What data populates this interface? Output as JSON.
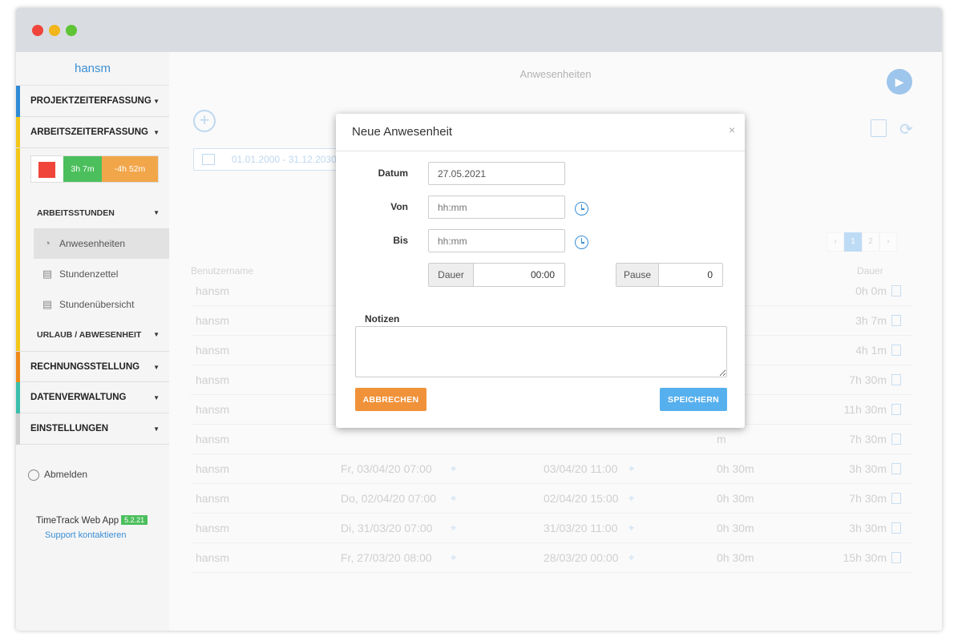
{
  "sidebar": {
    "username": "hansm",
    "sections": {
      "projekt": "PROJEKTZEITERFASSUNG",
      "arbeit": "ARBEITSZEITERFASSUNG",
      "rechnung": "RECHNUNGSSTELLUNG",
      "daten": "DATENVERWALTUNG",
      "einstellungen": "EINSTELLUNGEN"
    },
    "timer": {
      "worked": "3h 7m",
      "remaining": "-4h 52m"
    },
    "sub": {
      "arbeitsstunden": "ARBEITSSTUNDEN",
      "urlaub": "URLAUB / ABWESENHEIT"
    },
    "items": {
      "anwesenheiten": "Anwesenheiten",
      "stundenzettel": "Stundenzettel",
      "stundenuebersicht": "Stundenübersicht"
    },
    "logout": "Abmelden",
    "app_name": "TimeTrack Web App",
    "version": "5.2.21",
    "support": "Support kontaktieren"
  },
  "main": {
    "title": "Anwesenheiten",
    "date_range": "01.01.2000 - 31.12.2030",
    "pager": [
      "‹",
      "1",
      "2",
      "›"
    ],
    "columns": {
      "user": "Benutzername",
      "duration": "Dauer"
    },
    "rows": [
      {
        "user": "hansm",
        "from": "",
        "to": "",
        "pause": "h",
        "duration": "0h 0m"
      },
      {
        "user": "hansm",
        "from": "",
        "to": "",
        "pause": "h",
        "duration": "3h 7m"
      },
      {
        "user": "hansm",
        "from": "",
        "to": "",
        "pause": "h",
        "duration": "4h 1m"
      },
      {
        "user": "hansm",
        "from": "",
        "to": "",
        "pause": "m",
        "duration": "7h 30m"
      },
      {
        "user": "hansm",
        "from": "",
        "to": "",
        "pause": "m",
        "duration": "11h 30m"
      },
      {
        "user": "hansm",
        "from": "",
        "to": "",
        "pause": "m",
        "duration": "7h 30m"
      },
      {
        "user": "hansm",
        "from": "Fr, 03/04/20 07:00",
        "to": "03/04/20 11:00",
        "pause": "0h 30m",
        "duration": "3h 30m"
      },
      {
        "user": "hansm",
        "from": "Do, 02/04/20 07:00",
        "to": "02/04/20 15:00",
        "pause": "0h 30m",
        "duration": "7h 30m"
      },
      {
        "user": "hansm",
        "from": "Di, 31/03/20 07:00",
        "to": "31/03/20 11:00",
        "pause": "0h 30m",
        "duration": "3h 30m"
      },
      {
        "user": "hansm",
        "from": "Fr, 27/03/20 08:00",
        "to": "28/03/20 00:00",
        "pause": "0h 30m",
        "duration": "15h 30m"
      }
    ]
  },
  "modal": {
    "title": "Neue Anwesenheit",
    "close": "×",
    "datum_label": "Datum",
    "datum_value": "27.05.2021",
    "von_label": "Von",
    "von_placeholder": "hh:mm",
    "bis_label": "Bis",
    "bis_placeholder": "hh:mm",
    "dauer_label": "Dauer",
    "dauer_value": "00:00",
    "pause_label": "Pause",
    "pause_value": "0",
    "notizen_label": "Notizen",
    "cancel": "ABBRECHEN",
    "save": "SPEICHERN"
  },
  "colors": {
    "accent": "#3a8fd6",
    "cancel": "#f0923a",
    "save": "#57b0ee",
    "stop": "#f0453a",
    "worked": "#4cbf5d",
    "remaining": "#f2a64a"
  }
}
